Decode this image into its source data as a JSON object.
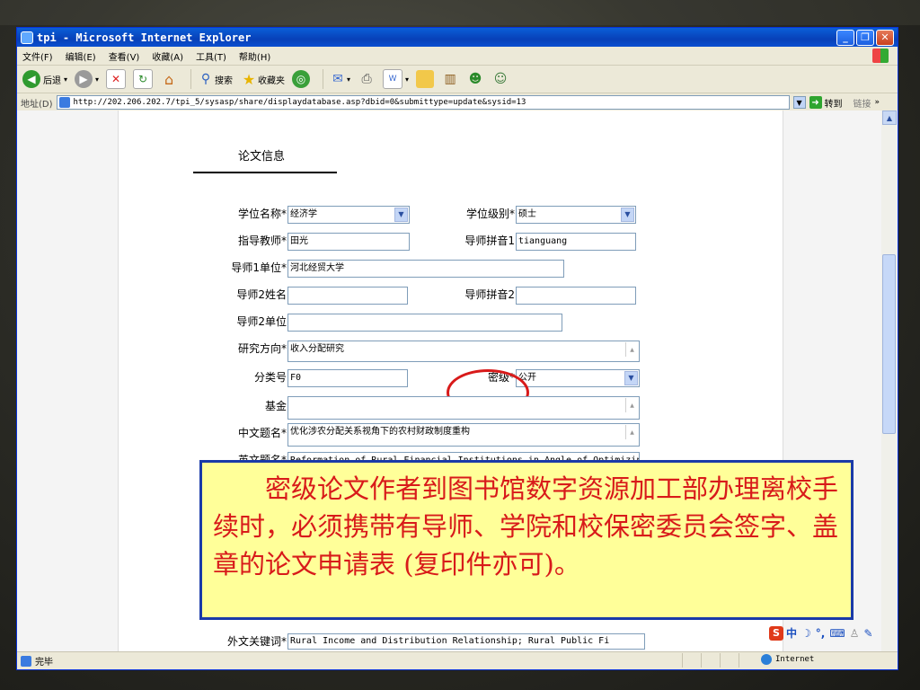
{
  "window": {
    "title": "tpi - Microsoft Internet Explorer"
  },
  "menu": [
    "文件(F)",
    "编辑(E)",
    "查看(V)",
    "收藏(A)",
    "工具(T)",
    "帮助(H)"
  ],
  "toolbar": {
    "back": "后退",
    "search": "搜索",
    "favorites": "收藏夹"
  },
  "address": {
    "label": "地址(D)",
    "url": "http://202.206.202.7/tpi_5/sysasp/share/displaydatabase.asp?dbid=0&submittype=update&sysid=13",
    "go": "转到",
    "links": "链接"
  },
  "form": {
    "title": "论文信息",
    "degree_name_label": "学位名称*",
    "degree_name_value": "经济学",
    "degree_level_label": "学位级别*",
    "degree_level_value": "硕士",
    "advisor_label": "指导教师*",
    "advisor_value": "田光",
    "advisor_pinyin1_label": "导师拼音1",
    "advisor_pinyin1_value": "tianguang",
    "advisor1_unit_label": "导师1单位*",
    "advisor1_unit_value": "河北经贸大学",
    "advisor2_name_label": "导师2姓名",
    "advisor2_name_value": "",
    "advisor_pinyin2_label": "导师拼音2",
    "advisor_pinyin2_value": "",
    "advisor2_unit_label": "导师2单位",
    "advisor2_unit_value": "",
    "research_label": "研究方向*",
    "research_value": "收入分配研究",
    "class_label": "分类号",
    "class_value": "F0",
    "secret_label": "密级*",
    "secret_value": "公开",
    "fund_label": "基金",
    "fund_value": "",
    "cn_title_label": "中文题名*",
    "cn_title_value": "优化涉农分配关系视角下的农村财政制度重构",
    "en_title_label": "英文题名*",
    "en_title_value": "Reformation of Rural Financial Institutions in Angle of Optimizing",
    "en_keywords_label": "外文关键词*",
    "en_keywords_value": "Rural Income and Distribution Relationship; Rural Public Fi"
  },
  "note": {
    "text": "密级论文作者到图书馆数字资源加工部办理离校手续时，必须携带有导师、学院和校保密委员会签字、盖章的论文申请表 (复印件亦可)。"
  },
  "status": {
    "text": "完毕",
    "zone": "Internet"
  },
  "ime": {
    "s": "S",
    "lang": "中",
    "moon": "☽",
    "punct": "°,",
    "kbd": "⌨",
    "person": "♙",
    "tool": "✎"
  }
}
